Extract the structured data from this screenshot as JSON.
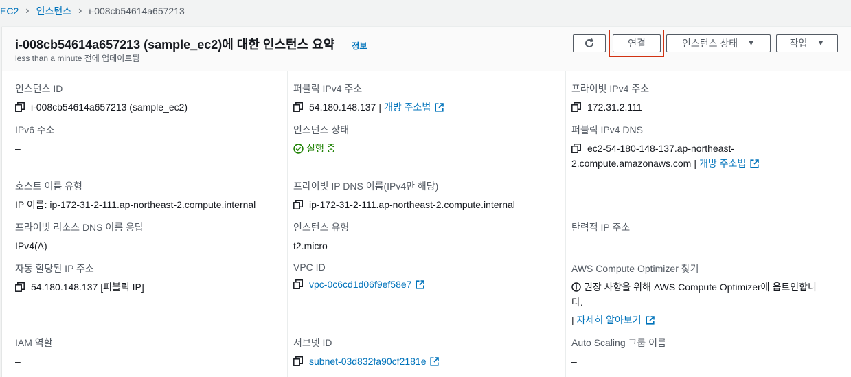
{
  "breadcrumb": [
    "EC2",
    "인스턴스",
    "i-008cb54614a657213"
  ],
  "header": {
    "title": "i-008cb54614a657213 (sample_ec2)에 대한 인스턴스 요약",
    "info_link": "정보",
    "subtitle": "less than a minute 전에 업데이트됨",
    "connect_label": "연결",
    "state_label": "인스턴스 상태",
    "actions_label": "작업"
  },
  "fields": {
    "instance_id": {
      "label": "인스턴스 ID",
      "value": "i-008cb54614a657213 (sample_ec2)"
    },
    "public_ipv4": {
      "label": "퍼블릭 IPv4 주소",
      "value": "54.180.148.137",
      "link": "개방 주소법"
    },
    "private_ipv4": {
      "label": "프라이빗 IPv4 주소",
      "value": "172.31.2.111"
    },
    "ipv6": {
      "label": "IPv6 주소",
      "value": "–"
    },
    "instance_state": {
      "label": "인스턴스 상태",
      "value": "실행 중"
    },
    "public_dns": {
      "label": "퍼블릭 IPv4 DNS",
      "value_line1": "ec2-54-180-148-137.ap-northeast-",
      "value_line2": "2.compute.amazonaws.com",
      "link": "개방 주소법"
    },
    "hostname_type": {
      "label": "호스트 이름 유형",
      "value": "IP 이름: ip-172-31-2-111.ap-northeast-2.compute.internal"
    },
    "private_dns": {
      "label": "프라이빗 IP DNS 이름(IPv4만 해당)",
      "value": "ip-172-31-2-111.ap-northeast-2.compute.internal"
    },
    "resource_dns": {
      "label": "프라이빗 리소스 DNS 이름 응답",
      "value": "IPv4(A)"
    },
    "instance_type": {
      "label": "인스턴스 유형",
      "value": "t2.micro"
    },
    "elastic_ip": {
      "label": "탄력적 IP 주소",
      "value": "–"
    },
    "auto_ip": {
      "label": "자동 할당된 IP 주소",
      "value": "54.180.148.137 [퍼블릭 IP]"
    },
    "vpc_id": {
      "label": "VPC ID",
      "value": "vpc-0c6cd1d06f9ef58e7"
    },
    "optimizer": {
      "label": "AWS Compute Optimizer 찾기",
      "value_line1": "권장 사항을 위해 AWS Compute Optimizer에 옵트인합니",
      "value_line2": "다.",
      "link": "자세히 알아보기"
    },
    "iam_role": {
      "label": "IAM 역할",
      "value": "–"
    },
    "subnet_id": {
      "label": "서브넷 ID",
      "value": "subnet-03d832fa90cf2181e"
    },
    "asg_name": {
      "label": "Auto Scaling 그룹 이름",
      "value": "–"
    }
  }
}
